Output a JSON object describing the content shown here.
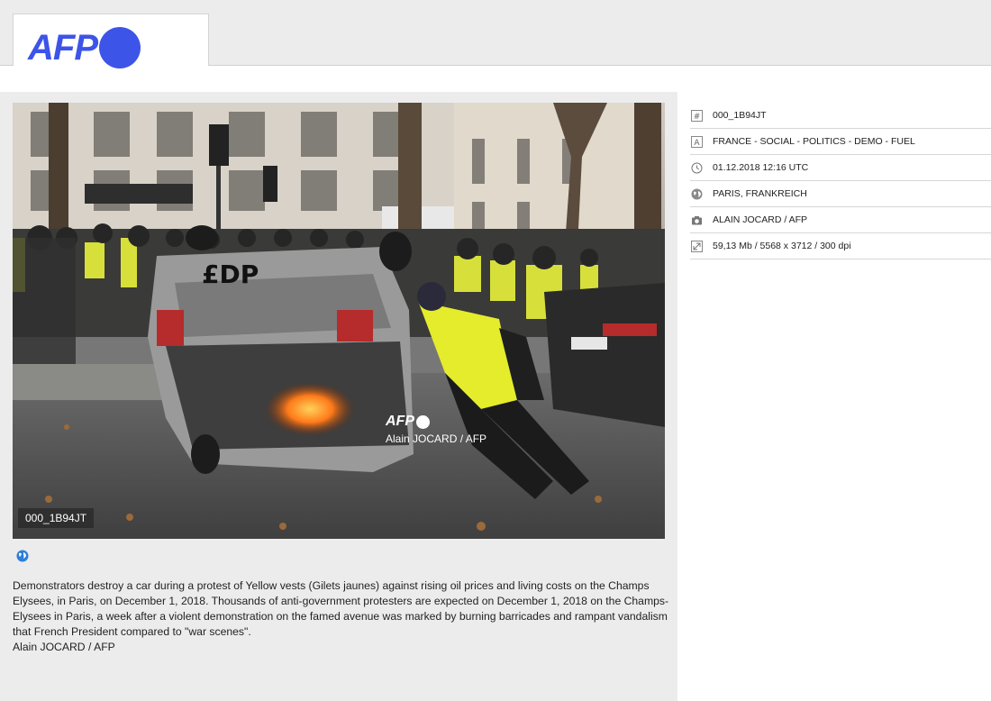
{
  "header": {
    "logo_text": "AFP"
  },
  "photo": {
    "watermark_logo": "AFP",
    "watermark_credit": "Alain JOCARD / AFP",
    "id_label": "000_1B94JT"
  },
  "caption": {
    "text": "Demonstrators destroy a car during a protest of Yellow vests (Gilets jaunes) against rising oil prices and living costs on the Champs Elysees, in Paris, on December 1, 2018. Thousands of anti-government protesters are expected on December 1, 2018 on the Champs-Elysees in Paris, a week after a violent demonstration on the famed avenue was marked by burning barricades and rampant vandalism that French President compared to \"war scenes\".",
    "credit": "Alain JOCARD / AFP"
  },
  "meta": [
    {
      "icon": "hash-icon",
      "value": "000_1B94JT"
    },
    {
      "icon": "text-icon",
      "value": "FRANCE - SOCIAL - POLITICS - DEMO - FUEL"
    },
    {
      "icon": "clock-icon",
      "value": "01.12.2018 12:16 UTC"
    },
    {
      "icon": "globe-icon",
      "value": "PARIS, FRANKREICH"
    },
    {
      "icon": "camera-icon",
      "value": "ALAIN JOCARD / AFP"
    },
    {
      "icon": "resize-icon",
      "value": "59,13 Mb / 5568 x 3712 / 300 dpi"
    }
  ],
  "colors": {
    "brand": "#3d54e8",
    "panel_bg": "#ececec"
  }
}
